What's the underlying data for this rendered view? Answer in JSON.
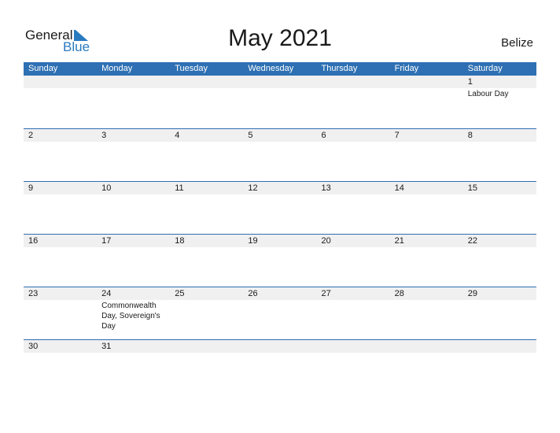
{
  "logo": {
    "general": "General",
    "blue": "Blue"
  },
  "title": "May 2021",
  "country": "Belize",
  "weekdays": [
    "Sunday",
    "Monday",
    "Tuesday",
    "Wednesday",
    "Thursday",
    "Friday",
    "Saturday"
  ],
  "weeks": [
    [
      {
        "d": ""
      },
      {
        "d": ""
      },
      {
        "d": ""
      },
      {
        "d": ""
      },
      {
        "d": ""
      },
      {
        "d": ""
      },
      {
        "d": "1",
        "e": "Labour Day"
      }
    ],
    [
      {
        "d": "2"
      },
      {
        "d": "3"
      },
      {
        "d": "4"
      },
      {
        "d": "5"
      },
      {
        "d": "6"
      },
      {
        "d": "7"
      },
      {
        "d": "8"
      }
    ],
    [
      {
        "d": "9"
      },
      {
        "d": "10"
      },
      {
        "d": "11"
      },
      {
        "d": "12"
      },
      {
        "d": "13"
      },
      {
        "d": "14"
      },
      {
        "d": "15"
      }
    ],
    [
      {
        "d": "16"
      },
      {
        "d": "17"
      },
      {
        "d": "18"
      },
      {
        "d": "19"
      },
      {
        "d": "20"
      },
      {
        "d": "21"
      },
      {
        "d": "22"
      }
    ],
    [
      {
        "d": "23"
      },
      {
        "d": "24",
        "e": "Commonwealth Day, Sovereign's Day"
      },
      {
        "d": "25"
      },
      {
        "d": "26"
      },
      {
        "d": "27"
      },
      {
        "d": "28"
      },
      {
        "d": "29"
      }
    ],
    [
      {
        "d": "30"
      },
      {
        "d": "31"
      },
      {
        "d": ""
      },
      {
        "d": ""
      },
      {
        "d": ""
      },
      {
        "d": ""
      },
      {
        "d": ""
      }
    ]
  ]
}
